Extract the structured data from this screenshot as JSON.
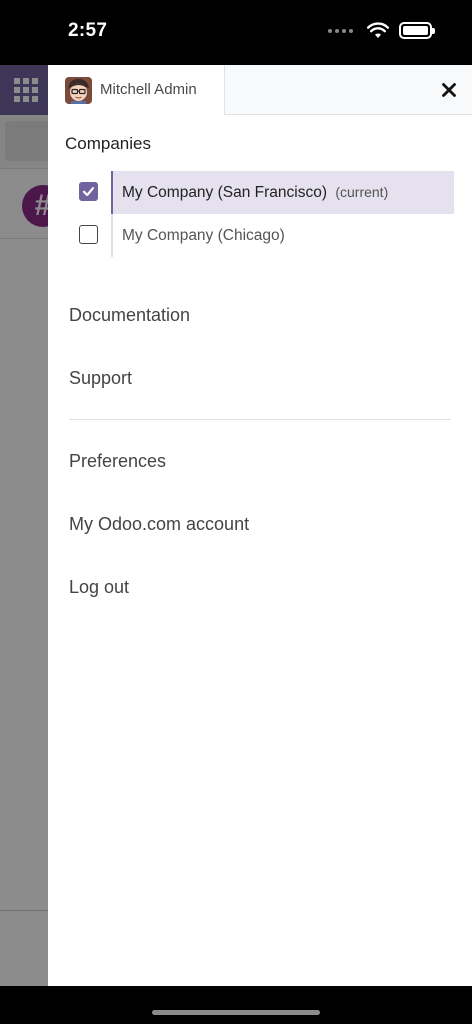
{
  "status_bar": {
    "time": "2:57",
    "icons": [
      "signal-dots-icon",
      "wifi-icon",
      "battery-icon"
    ]
  },
  "drawer": {
    "user": {
      "name": "Mitchell Admin",
      "avatar_icon": "user-avatar-icon"
    },
    "close_icon": "close-icon",
    "companies_title": "Companies",
    "companies": [
      {
        "name": "My Company (San Francisco)",
        "tag": "(current)",
        "checked": true
      },
      {
        "name": "My Company (Chicago)",
        "tag": "",
        "checked": false
      }
    ],
    "menu": {
      "documentation": "Documentation",
      "support": "Support",
      "preferences": "Preferences",
      "odoo_account": "My Odoo.com account",
      "logout": "Log out"
    }
  },
  "background_app": {
    "channel_symbol": "#"
  },
  "colors": {
    "brand": "#71639e",
    "active_row": "#e5e1ee",
    "channel": "#8a2c8a"
  }
}
